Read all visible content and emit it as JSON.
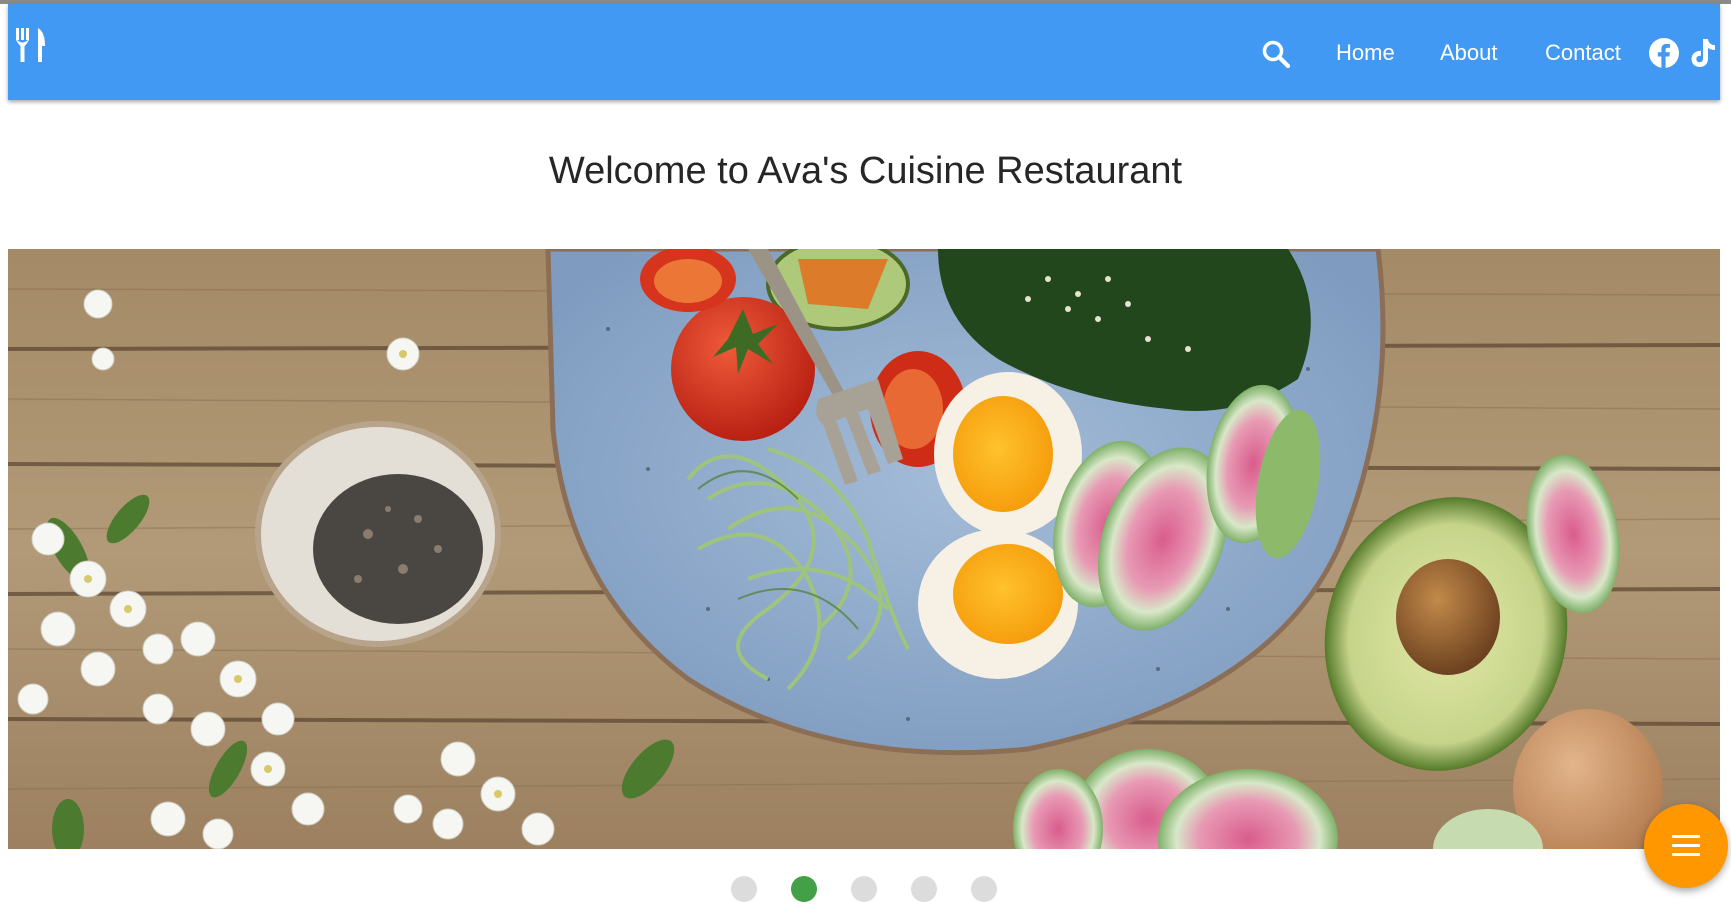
{
  "header": {
    "logo_icon": "fork-knife-icon",
    "search_icon": "search-icon",
    "nav": {
      "home": "Home",
      "about": "About",
      "contact": "Contact"
    },
    "social": [
      "facebook-icon",
      "tiktok-icon"
    ],
    "background_color": "#4299f4"
  },
  "main": {
    "title": "Welcome to Ava's Cuisine Restaurant",
    "hero_image": "salad-bowl-photo"
  },
  "carousel": {
    "slide_count": 5,
    "active_index": 1,
    "active_color": "#43a047",
    "inactive_color": "#dcdcdc"
  },
  "fab": {
    "icon": "menu-icon",
    "color": "#ff9800"
  }
}
